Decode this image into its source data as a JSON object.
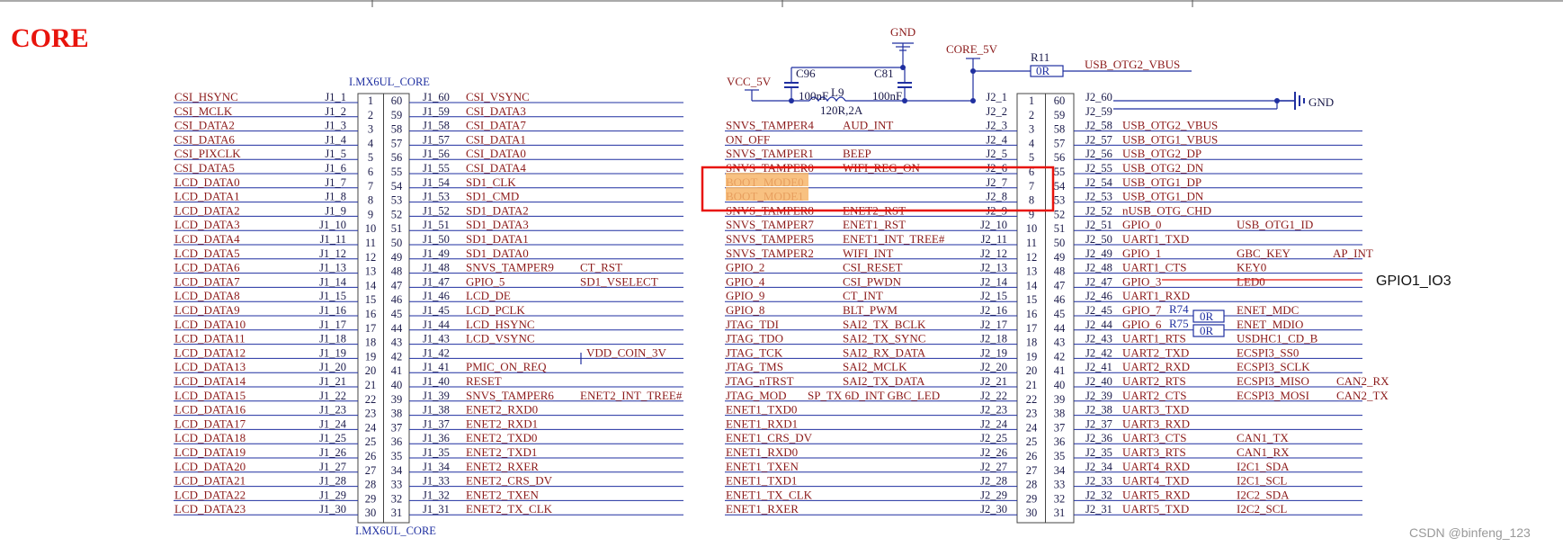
{
  "title": "CORE",
  "watermark": "CSDN @binfeng_123",
  "annotation": "GPIO1_IO3",
  "colors": {
    "net_red": "#8b1a1a",
    "wire_blue": "#1f2fa0",
    "highlight": "#f7b66b",
    "box_red": "#e8140c",
    "title_red": "#e8140c"
  },
  "j1": {
    "label_top": "I.MX6UL_CORE",
    "label_bottom": "I.MX6UL_CORE",
    "left_nets": [
      "CSI_HSYNC",
      "CSI_MCLK",
      "CSI_DATA2",
      "CSI_DATA6",
      "CSI_PIXCLK",
      "CSI_DATA5",
      "LCD_DATA0",
      "LCD_DATA1",
      "LCD_DATA2",
      "LCD_DATA3",
      "LCD_DATA4",
      "LCD_DATA5",
      "LCD_DATA6",
      "LCD_DATA7",
      "LCD_DATA8",
      "LCD_DATA9",
      "LCD_DATA10",
      "LCD_DATA11",
      "LCD_DATA12",
      "LCD_DATA13",
      "LCD_DATA14",
      "LCD_DATA15",
      "LCD_DATA16",
      "LCD_DATA17",
      "LCD_DATA18",
      "LCD_DATA19",
      "LCD_DATA20",
      "LCD_DATA21",
      "LCD_DATA22",
      "LCD_DATA23"
    ],
    "left_pins": [
      "J1_1",
      "J1_2",
      "J1_3",
      "J1_4",
      "J1_5",
      "J1_6",
      "J1_7",
      "J1_8",
      "J1_9",
      "J1_10",
      "J1_11",
      "J1_12",
      "J1_13",
      "J1_14",
      "J1_15",
      "J1_16",
      "J1_17",
      "J1_18",
      "J1_19",
      "J1_20",
      "J1_21",
      "J1_22",
      "J1_23",
      "J1_24",
      "J1_25",
      "J1_26",
      "J1_27",
      "J1_28",
      "J1_29",
      "J1_30"
    ],
    "right_pins": [
      "J1_60",
      "J1_59",
      "J1_58",
      "J1_57",
      "J1_56",
      "J1_55",
      "J1_54",
      "J1_53",
      "J1_52",
      "J1_51",
      "J1_50",
      "J1_49",
      "J1_48",
      "J1_47",
      "J1_46",
      "J1_45",
      "J1_44",
      "J1_43",
      "J1_42",
      "J1_41",
      "J1_40",
      "J1_39",
      "J1_38",
      "J1_37",
      "J1_36",
      "J1_35",
      "J1_34",
      "J1_33",
      "J1_32",
      "J1_31"
    ],
    "right_nets": [
      "CSI_VSYNC",
      "CSI_DATA3",
      "CSI_DATA7",
      "CSI_DATA1",
      "CSI_DATA0",
      "CSI_DATA4",
      "SD1_CLK",
      "SD1_CMD",
      "SD1_DATA2",
      "SD1_DATA3",
      "SD1_DATA1",
      "SD1_DATA0",
      "SNVS_TAMPER9",
      "GPIO_5",
      "LCD_DE",
      "LCD_PCLK",
      "LCD_HSYNC",
      "LCD_VSYNC",
      "",
      "PMIC_ON_REQ",
      "RESET",
      "SNVS_TAMPER6",
      "ENET2_RXD0",
      "ENET2_RXD1",
      "ENET2_TXD0",
      "ENET2_TXD1",
      "ENET2_RXER",
      "ENET2_CRS_DV",
      "ENET2_TXEN",
      "ENET2_TX_CLK"
    ],
    "right_nets2": [
      "",
      "",
      "",
      "",
      "",
      "",
      "",
      "",
      "",
      "",
      "",
      "",
      "CT_RST",
      "SD1_VSELECT",
      "",
      "",
      "",
      "",
      "VDD_COIN_3V",
      "",
      "",
      "ENET2_INT_TREE#",
      "",
      "",
      "",
      "",
      "",
      "",
      "",
      ""
    ]
  },
  "j2": {
    "left_nets": [
      "",
      "",
      "SNVS_TAMPER4",
      "ON_OFF",
      "SNVS_TAMPER1",
      "SNVS_TAMPER0",
      "BOOT_MODE0",
      "BOOT_MODE1",
      "SNVS_TAMPER8",
      "SNVS_TAMPER7",
      "SNVS_TAMPER5",
      "SNVS_TAMPER2",
      "GPIO_2",
      "GPIO_4",
      "GPIO_9",
      "GPIO_8",
      "JTAG_TDI",
      "JTAG_TDO",
      "JTAG_TCK",
      "JTAG_TMS",
      "JTAG_nTRST",
      "JTAG_MOD",
      "ENET1_TXD0",
      "ENET1_RXD1",
      "ENET1_CRS_DV",
      "ENET1_RXD0",
      "ENET1_TXEN",
      "ENET1_TXD1",
      "ENET1_TX_CLK",
      "ENET1_RXER"
    ],
    "left_nets2": [
      "",
      "",
      "AUD_INT",
      "",
      "BEEP",
      "WIFI_REG_ON",
      "",
      "",
      "ENET2_RST",
      "ENET1_RST",
      "ENET1_INT_TREE#",
      "WIFI_INT",
      "CSI_RESET",
      "CSI_PWDN",
      "CT_INT",
      "BLT_PWM",
      "SAI2_TX_BCLK",
      "SAI2_TX_SYNC",
      "SAI2_RX_DATA",
      "SAI2_MCLK",
      "SAI2_TX_DATA",
      "SP_TX    6D_INT    GBC_LED",
      "",
      "",
      "",
      "",
      "",
      "",
      "",
      ""
    ],
    "left_pins": [
      "J2_1",
      "J2_2",
      "J2_3",
      "J2_4",
      "J2_5",
      "J2_6",
      "J2_7",
      "J2_8",
      "J2_9",
      "J2_10",
      "J2_11",
      "J2_12",
      "J2_13",
      "J2_14",
      "J2_15",
      "J2_16",
      "J2_17",
      "J2_18",
      "J2_19",
      "J2_20",
      "J2_21",
      "J2_22",
      "J2_23",
      "J2_24",
      "J2_25",
      "J2_26",
      "J2_27",
      "J2_28",
      "J2_29",
      "J2_30"
    ],
    "right_pins": [
      "J2_60",
      "J2_59",
      "J2_58",
      "J2_57",
      "J2_56",
      "J2_55",
      "J2_54",
      "J2_53",
      "J2_52",
      "J2_51",
      "J2_50",
      "J2_49",
      "J2_48",
      "J2_47",
      "J2_46",
      "J2_45",
      "J2_44",
      "J2_43",
      "J2_42",
      "J2_41",
      "J2_40",
      "J2_39",
      "J2_38",
      "J2_37",
      "J2_36",
      "J2_35",
      "J2_34",
      "J2_33",
      "J2_32",
      "J2_31"
    ],
    "right_nets": [
      "",
      "",
      "USB_OTG2_VBUS",
      "USB_OTG1_VBUS",
      "USB_OTG2_DP",
      "USB_OTG2_DN",
      "USB_OTG1_DP",
      "USB_OTG1_DN",
      "nUSB_OTG_CHD",
      "GPIO_0",
      "UART1_TXD",
      "GPIO_1",
      "UART1_CTS",
      "GPIO_3",
      "UART1_RXD",
      "GPIO_7",
      "GPIO_6",
      "UART1_RTS",
      "UART2_TXD",
      "UART2_RXD",
      "UART2_RTS",
      "UART2_CTS",
      "UART3_TXD",
      "UART3_RXD",
      "UART3_CTS",
      "UART3_RTS",
      "UART4_RXD",
      "UART4_TXD",
      "UART5_RXD",
      "UART5_TXD"
    ],
    "right_nets2": [
      "",
      "",
      "",
      "",
      "",
      "",
      "",
      "",
      "",
      "USB_OTG1_ID",
      "",
      "GBC_KEY",
      "KEY0",
      "LED0",
      "",
      "ENET_MDC",
      "ENET_MDIO",
      "USDHC1_CD_B",
      "ECSPI3_SS0",
      "ECSPI3_SCLK",
      "ECSPI3_MISO",
      "ECSPI3_MOSI",
      "",
      "",
      "CAN1_TX",
      "CAN1_RX",
      "I2C1_SDA",
      "I2C1_SCL",
      "I2C2_SDA",
      "I2C2_SCL"
    ],
    "right_nets3": [
      "",
      "",
      "",
      "",
      "",
      "",
      "",
      "",
      "",
      "",
      "",
      "AP_INT",
      "",
      "",
      "",
      "",
      "",
      "",
      "",
      "",
      "CAN2_RX",
      "CAN2_TX",
      "",
      "",
      "",
      "",
      "",
      "",
      "",
      ""
    ]
  },
  "power": {
    "gnd_top": "GND",
    "gnd_right": "GND",
    "vcc": "VCC_5V",
    "core_5v": "CORE_5V",
    "c96": "C96",
    "c96_val": "100nF",
    "c81": "C81",
    "c81_val": "100nF",
    "l9": "L9",
    "l9_val": "120R,2A",
    "r11": "R11",
    "r11_val": "0R",
    "usb_vbus": "USB_OTG2_VBUS",
    "r74": "R74",
    "r74_val": "0R",
    "r75": "R75",
    "r75_val": "0R"
  }
}
